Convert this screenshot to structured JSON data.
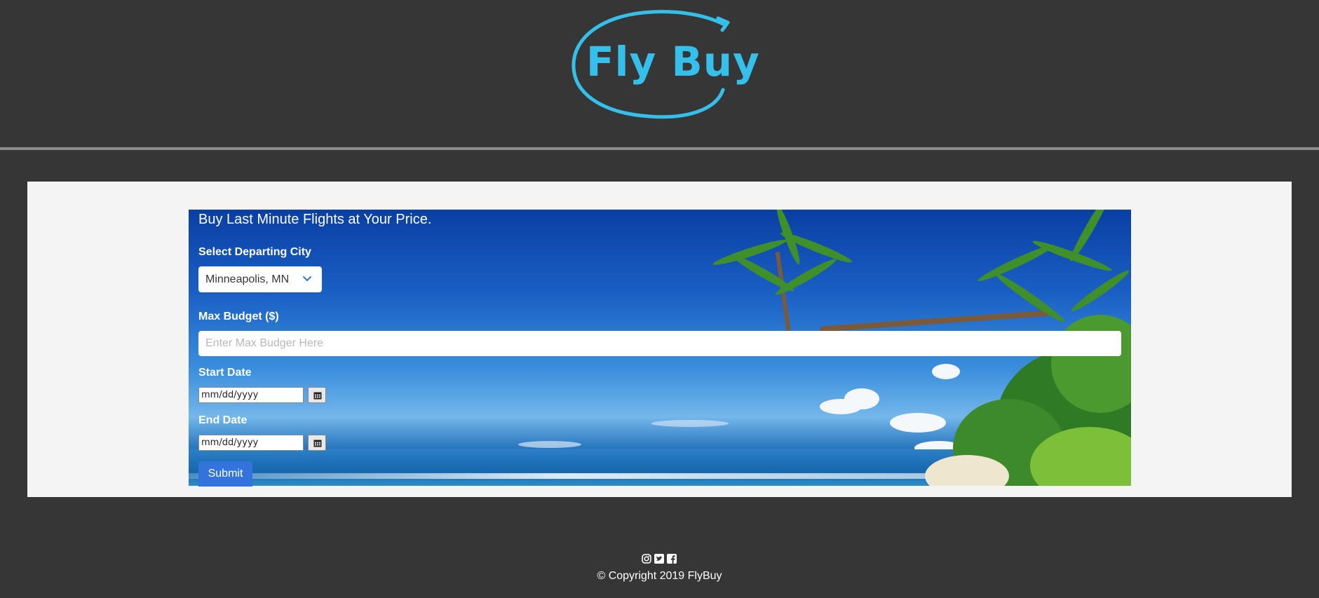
{
  "header": {
    "logo_text": "Fly Buy",
    "accent_color": "#35c0ec",
    "logo_icon": "arrow-loop-logo"
  },
  "hero": {
    "tagline": "Buy Last Minute Flights at Your Price.",
    "background": "tropical-beach-palm-trees-photo"
  },
  "form": {
    "departing_city_label": "Select Departing City",
    "departing_city_value": "Minneapolis, MN",
    "budget_label": "Max Budget ($)",
    "budget_placeholder": "Enter Max Budger Here",
    "start_date_label": "Start Date",
    "start_date_placeholder": "mm/dd/yyyy",
    "end_date_label": "End Date",
    "end_date_placeholder": "mm/dd/yyyy",
    "submit_label": "Submit",
    "submit_color": "#3273dc"
  },
  "footer": {
    "icons": [
      "instagram-icon",
      "twitter-icon",
      "facebook-icon"
    ],
    "copyright": "© Copyright 2019 FlyBuy"
  }
}
